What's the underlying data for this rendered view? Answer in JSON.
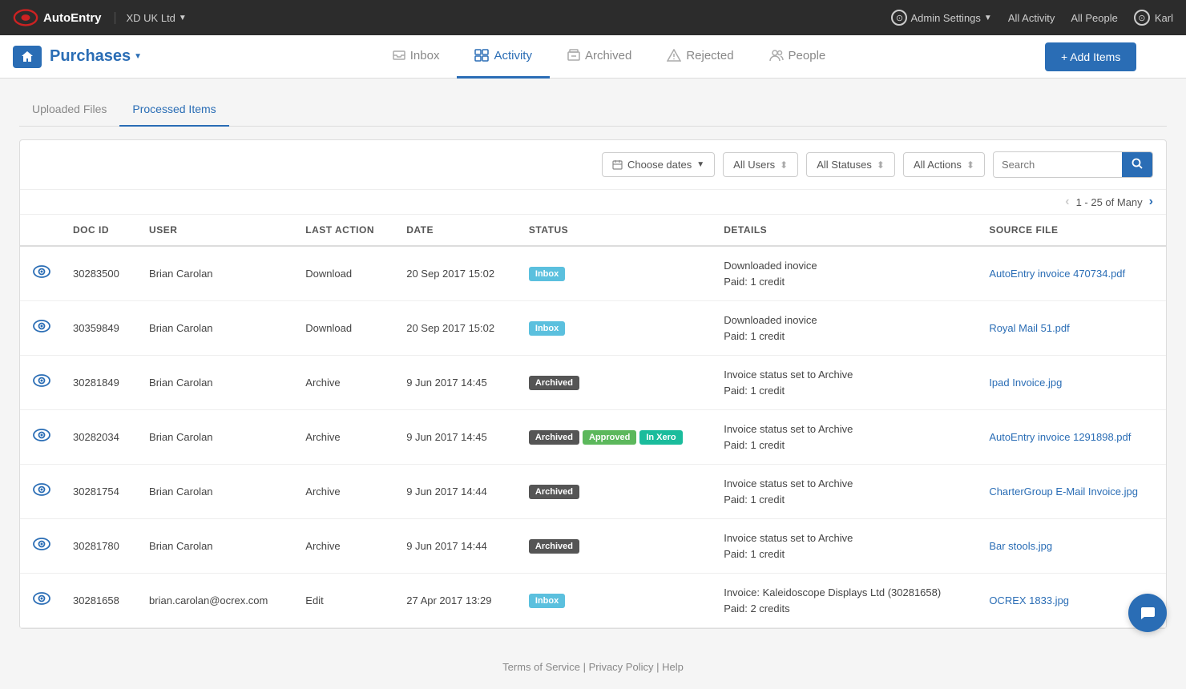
{
  "topNav": {
    "logo_alt": "AutoEntry",
    "company": "XD UK Ltd",
    "admin_settings": "Admin Settings",
    "all_activity": "All Activity",
    "all_people": "All People",
    "user": "Karl"
  },
  "subNav": {
    "section_title": "Purchases",
    "tabs": [
      {
        "id": "inbox",
        "label": "Inbox",
        "icon": "inbox",
        "active": false
      },
      {
        "id": "activity",
        "label": "Activity",
        "icon": "activity",
        "active": true
      },
      {
        "id": "archived",
        "label": "Archived",
        "icon": "archived",
        "active": false
      },
      {
        "id": "rejected",
        "label": "Rejected",
        "icon": "rejected",
        "active": false
      },
      {
        "id": "people",
        "label": "People",
        "icon": "people",
        "active": false
      }
    ],
    "add_items_btn": "+ Add Items"
  },
  "secondaryTabs": [
    {
      "id": "uploaded",
      "label": "Uploaded Files",
      "active": false
    },
    {
      "id": "processed",
      "label": "Processed Items",
      "active": true
    }
  ],
  "filterBar": {
    "choose_dates": "Choose dates",
    "all_users": "All Users",
    "all_statuses": "All Statuses",
    "all_actions": "All Actions",
    "search_placeholder": "Search"
  },
  "pagination": {
    "text": "1 - 25 of Many"
  },
  "table": {
    "columns": [
      "",
      "DOC ID",
      "USER",
      "LAST ACTION",
      "DATE",
      "STATUS",
      "DETAILS",
      "SOURCE FILE"
    ],
    "rows": [
      {
        "doc_id": "30283500",
        "user": "Brian Carolan",
        "last_action": "Download",
        "date": "20 Sep 2017 15:02",
        "status_badges": [
          {
            "label": "Inbox",
            "type": "inbox"
          }
        ],
        "details_line1": "Downloaded inovice",
        "details_line2": "Paid: 1 credit",
        "source_file": "AutoEntry invoice 470734.pdf"
      },
      {
        "doc_id": "30359849",
        "user": "Brian Carolan",
        "last_action": "Download",
        "date": "20 Sep 2017 15:02",
        "status_badges": [
          {
            "label": "Inbox",
            "type": "inbox"
          }
        ],
        "details_line1": "Downloaded inovice",
        "details_line2": "Paid: 1 credit",
        "source_file": "Royal Mail 51.pdf"
      },
      {
        "doc_id": "30281849",
        "user": "Brian Carolan",
        "last_action": "Archive",
        "date": "9 Jun 2017 14:45",
        "status_badges": [
          {
            "label": "Archived",
            "type": "archived"
          }
        ],
        "details_line1": "Invoice status set to Archive",
        "details_line2": "Paid: 1 credit",
        "source_file": "Ipad Invoice.jpg"
      },
      {
        "doc_id": "30282034",
        "user": "Brian Carolan",
        "last_action": "Archive",
        "date": "9 Jun 2017 14:45",
        "status_badges": [
          {
            "label": "Archived",
            "type": "archived"
          },
          {
            "label": "Approved",
            "type": "approved"
          },
          {
            "label": "In Xero",
            "type": "inxero"
          }
        ],
        "details_line1": "Invoice status set to Archive",
        "details_line2": "Paid: 1 credit",
        "source_file": "AutoEntry invoice 1291898.pdf"
      },
      {
        "doc_id": "30281754",
        "user": "Brian Carolan",
        "last_action": "Archive",
        "date": "9 Jun 2017 14:44",
        "status_badges": [
          {
            "label": "Archived",
            "type": "archived"
          }
        ],
        "details_line1": "Invoice status set to Archive",
        "details_line2": "Paid: 1 credit",
        "source_file": "CharterGroup E-Mail Invoice.jpg"
      },
      {
        "doc_id": "30281780",
        "user": "Brian Carolan",
        "last_action": "Archive",
        "date": "9 Jun 2017 14:44",
        "status_badges": [
          {
            "label": "Archived",
            "type": "archived"
          }
        ],
        "details_line1": "Invoice status set to Archive",
        "details_line2": "Paid: 1 credit",
        "source_file": "Bar stools.jpg"
      },
      {
        "doc_id": "30281658",
        "user": "brian.carolan@ocrex.com",
        "last_action": "Edit",
        "date": "27 Apr 2017 13:29",
        "status_badges": [
          {
            "label": "Inbox",
            "type": "inbox"
          }
        ],
        "details_line1": "Invoice: Kaleidoscope Displays Ltd (30281658)",
        "details_line2": "Paid: 2 credits",
        "source_file": "OCREX 1833.jpg"
      }
    ]
  },
  "footer": {
    "terms": "Terms of Service",
    "privacy": "Privacy Policy",
    "help": "Help",
    "sep": "|"
  }
}
